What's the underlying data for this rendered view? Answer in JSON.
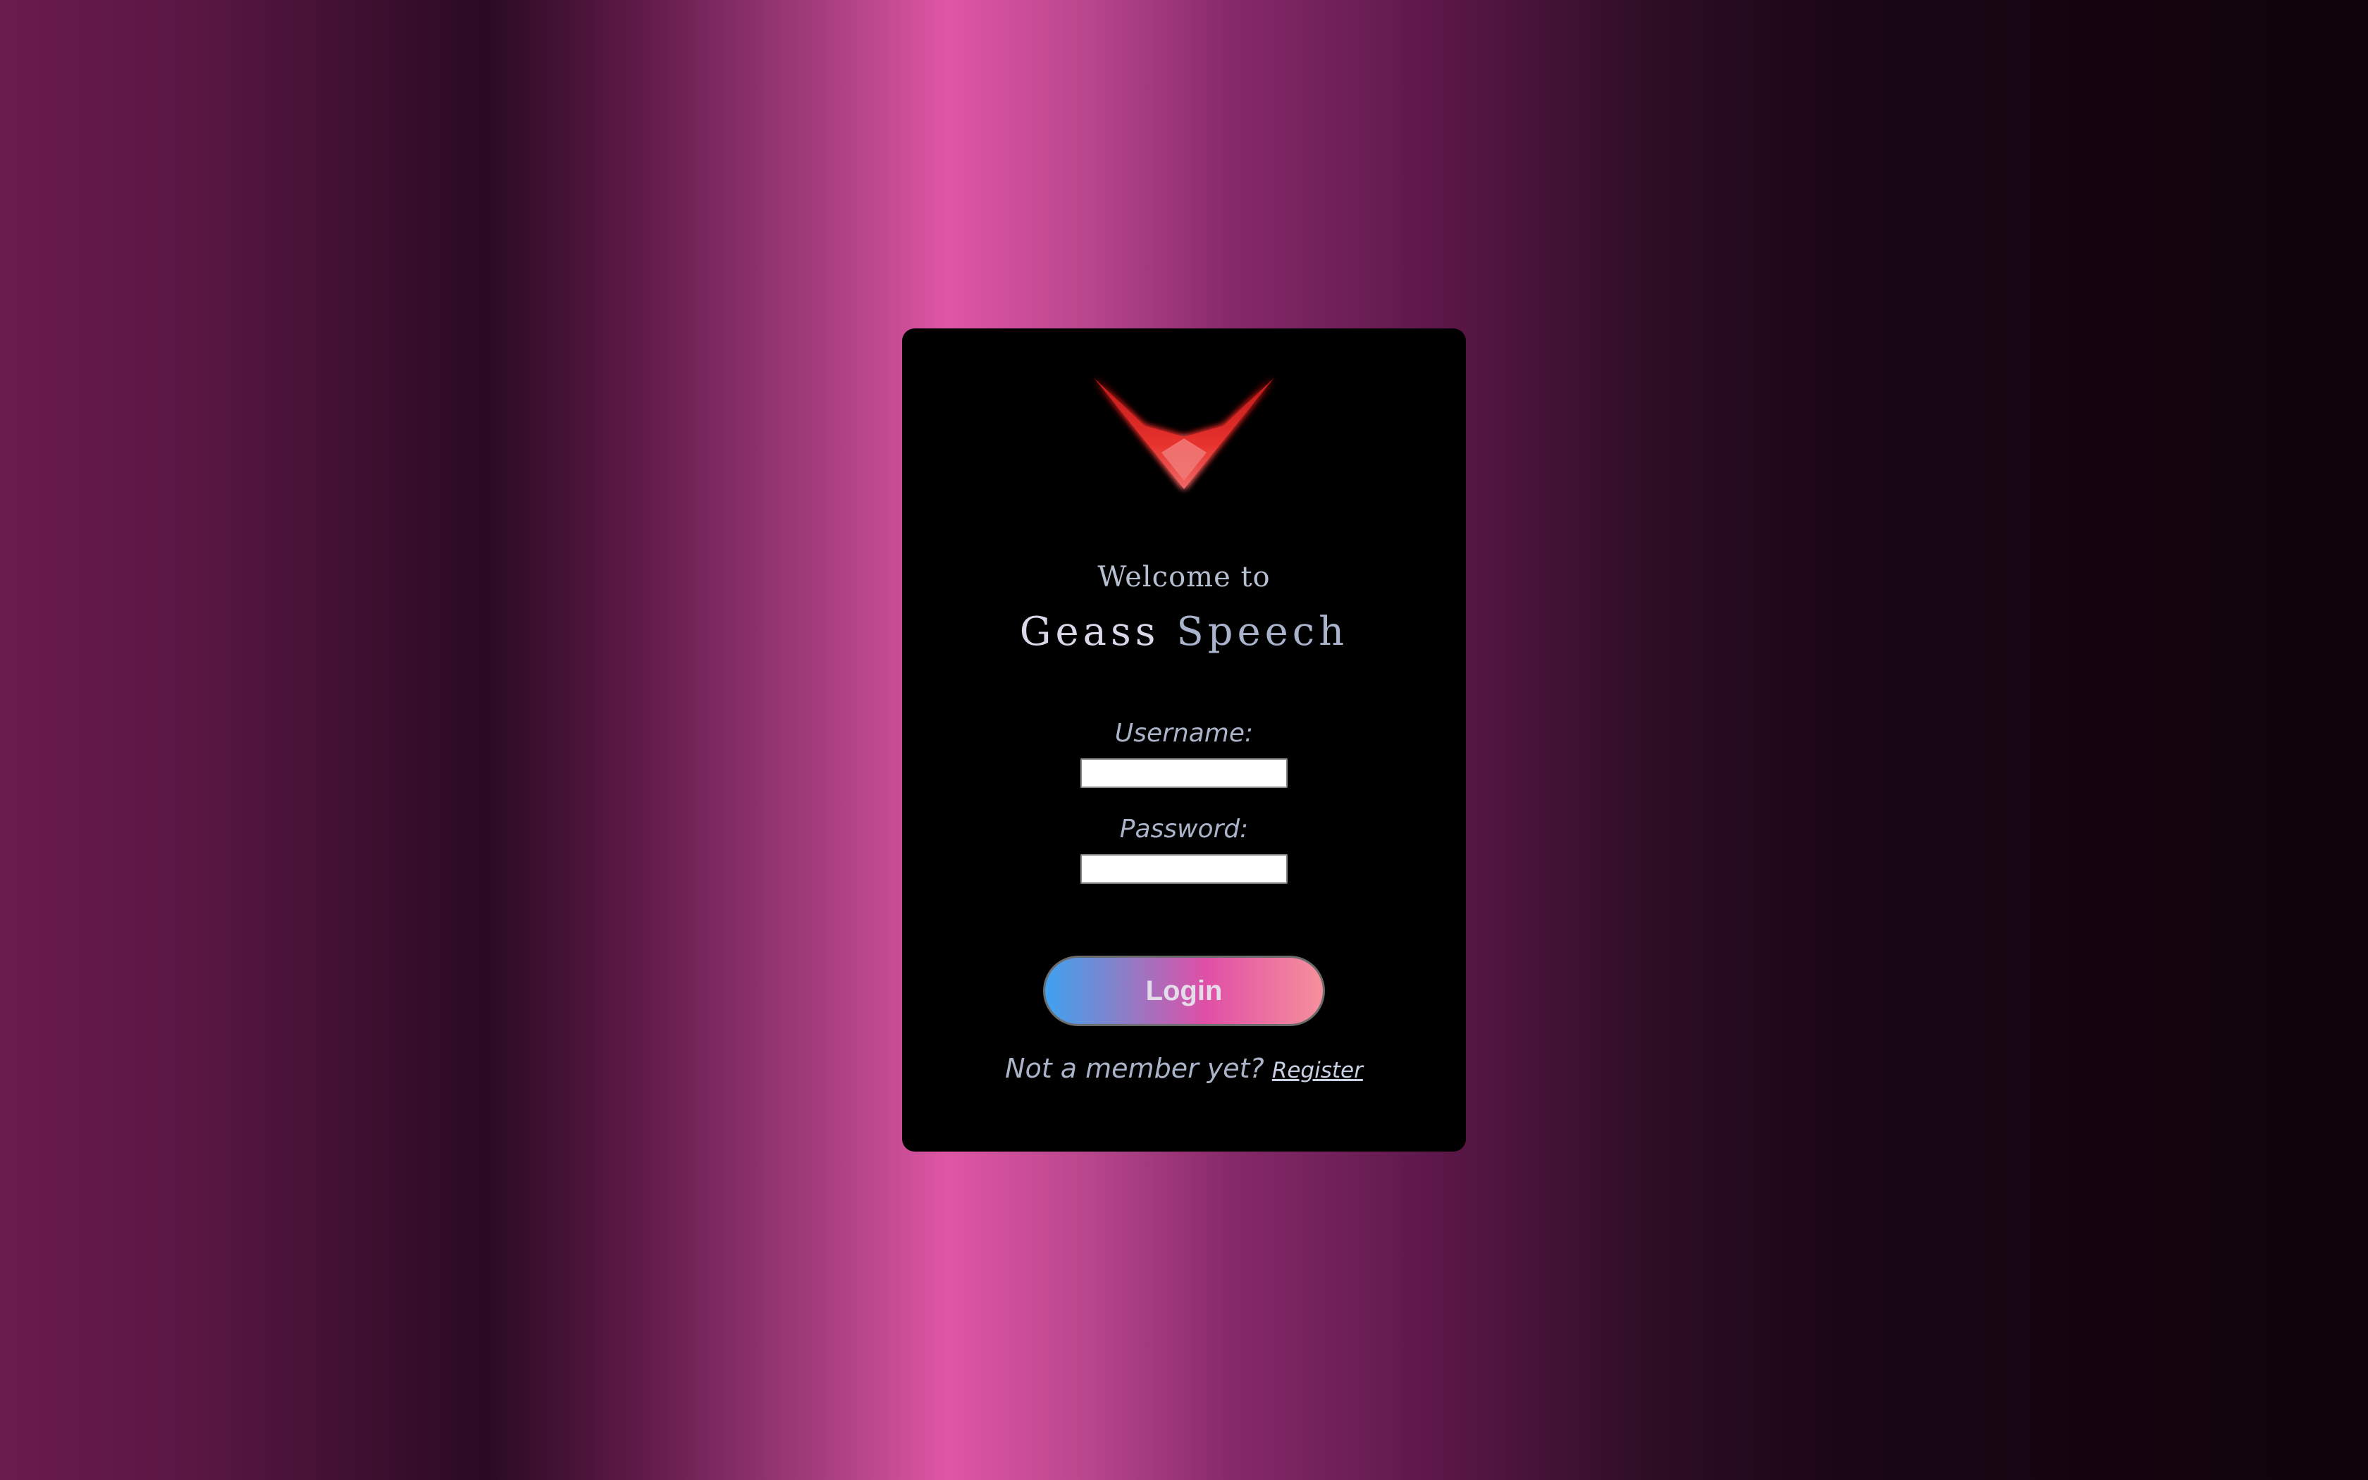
{
  "login_card": {
    "logo_icon": "geass-sigil-icon",
    "welcome_text": "Welcome to",
    "brand": {
      "word1": "Geass",
      "word2": "Speech"
    },
    "username": {
      "label": "Username:",
      "value": "",
      "placeholder": ""
    },
    "password": {
      "label": "Password:",
      "value": "",
      "placeholder": ""
    },
    "login_button_label": "Login",
    "register_prompt": "Not a member yet?",
    "register_link": "Register"
  },
  "colors": {
    "background_accent": "#df56a4",
    "card_background": "#000000",
    "logo_red": "#e8322e",
    "text_muted": "#aab3c8",
    "button_gradient_start": "#3fa2f0",
    "button_gradient_mid": "#e04fa6",
    "button_gradient_end": "#f5909c"
  }
}
